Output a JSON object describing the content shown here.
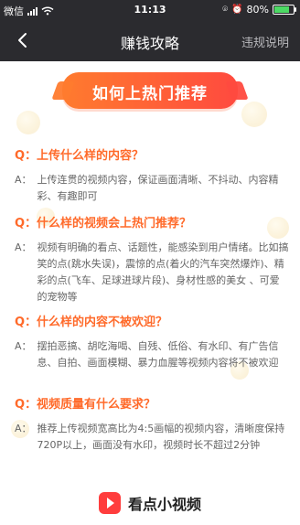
{
  "status_bar": {
    "carrier": "微信",
    "time": "11:13",
    "battery": "80%",
    "battery_level": 0.8
  },
  "nav": {
    "title": "赚钱攻略",
    "right_label": "违规说明"
  },
  "banner": {
    "title": "如何上热门推荐"
  },
  "qa": [
    {
      "q": "Q：上传什么样的内容？",
      "a_prefix": "A：",
      "a": "上传连贯的视频内容，保证画面清晰、不抖动、内容精彩、有趣即可"
    },
    {
      "q": "Q：什么样的视频会上热门推荐？",
      "a_prefix": "A：",
      "a": "视频有明确的看点、话题性，能感染到用户情绪。比如搞笑的点(跳水失误)，震惊的点(着火的汽车突然爆炸)、精彩的点(飞车、足球进球片段)、身材性感的美女 、可爱的宠物等"
    },
    {
      "q": "Q：什么样的内容不被欢迎？",
      "a_prefix": "A：",
      "a": "摆拍恶搞、胡吃海喝、自残、低俗、有水印、有广告信息、自拍、画面模糊、暴力血腥等视频内容将不被欢迎"
    },
    {
      "q": "Q：视频质量有什么要求？",
      "a_prefix": "A：",
      "a": "推荐上传视频宽高比为4:5画幅的视频内容，清晰度保持720P以上，画面没有水印，视频时长不超过2分钟"
    }
  ],
  "footer": {
    "brand": "看点小视频"
  },
  "colors": {
    "nav_bg": "#2b2b2f",
    "accent_orange": "#ff6a2a",
    "answer_text": "#666666"
  }
}
